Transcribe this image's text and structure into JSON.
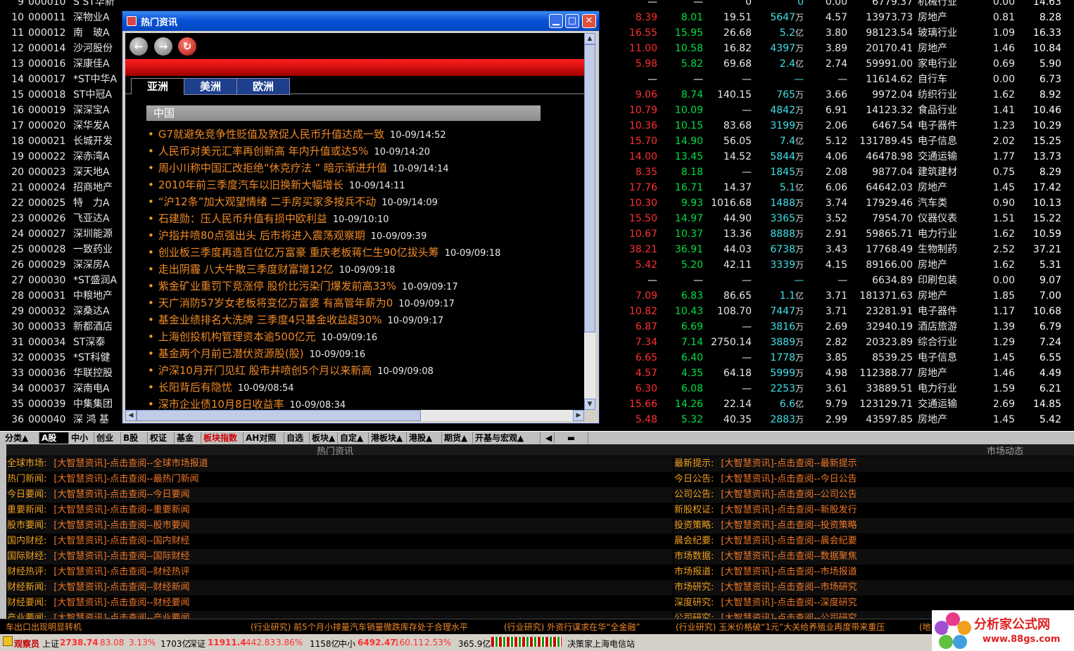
{
  "rows": [
    {
      "no": "9",
      "code": "000010",
      "name": "S ST华新",
      "a": "—",
      "b": "—",
      "c": "0",
      "d": "0",
      "e": "0.00",
      "f": "6779.37",
      "g": "机械行业",
      "h": "0.00",
      "i": "14.63"
    },
    {
      "no": "10",
      "code": "000011",
      "name": "深物业A",
      "a": "8.39",
      "b": "8.01",
      "c": "19.51",
      "d": "5647",
      "du": "万",
      "e": "4.57",
      "f": "13973.73",
      "g": "房地产",
      "h": "0.81",
      "i": "8.28"
    },
    {
      "no": "11",
      "code": "000012",
      "name": "南　玻A",
      "a": "16.55",
      "b": "15.95",
      "c": "26.68",
      "d": "5.2",
      "du": "亿",
      "e": "3.80",
      "f": "98123.54",
      "g": "玻璃行业",
      "h": "1.09",
      "i": "16.33"
    },
    {
      "no": "12",
      "code": "000014",
      "name": "沙河股份",
      "a": "11.00",
      "b": "10.58",
      "c": "16.82",
      "d": "4397",
      "du": "万",
      "e": "3.89",
      "f": "20170.41",
      "g": "房地产",
      "h": "1.46",
      "i": "10.84"
    },
    {
      "no": "13",
      "code": "000016",
      "name": "深康佳A",
      "a": "5.98",
      "b": "5.82",
      "c": "69.68",
      "d": "2.4",
      "du": "亿",
      "e": "2.74",
      "f": "59991.00",
      "g": "家电行业",
      "h": "0.69",
      "i": "5.90"
    },
    {
      "no": "14",
      "code": "000017",
      "name": "*ST中华A",
      "a": "—",
      "b": "—",
      "c": "—",
      "d": "—",
      "e": "—",
      "f": "11614.62",
      "g": "自行车",
      "h": "0.00",
      "i": "6.73"
    },
    {
      "no": "15",
      "code": "000018",
      "name": "ST中冠A",
      "a": "9.06",
      "b": "8.74",
      "c": "140.15",
      "d": "765",
      "du": "万",
      "e": "3.66",
      "f": "9972.04",
      "g": "纺织行业",
      "h": "1.62",
      "i": "8.92"
    },
    {
      "no": "16",
      "code": "000019",
      "name": "深深宝A",
      "a": "10.79",
      "b": "10.09",
      "c": "—",
      "d": "4842",
      "du": "万",
      "e": "6.91",
      "f": "14123.32",
      "g": "食品行业",
      "h": "1.41",
      "i": "10.46"
    },
    {
      "no": "17",
      "code": "000020",
      "name": "深华发A",
      "a": "10.36",
      "b": "10.15",
      "c": "83.68",
      "d": "3199",
      "du": "万",
      "e": "2.06",
      "f": "6467.54",
      "g": "电子器件",
      "h": "1.23",
      "i": "10.29"
    },
    {
      "no": "18",
      "code": "000021",
      "name": "长城开发",
      "a": "15.70",
      "b": "14.90",
      "c": "56.05",
      "d": "7.4",
      "du": "亿",
      "e": "5.12",
      "f": "131789.45",
      "g": "电子信息",
      "h": "2.02",
      "i": "15.25"
    },
    {
      "no": "19",
      "code": "000022",
      "name": "深赤湾A",
      "a": "14.00",
      "b": "13.45",
      "c": "14.52",
      "d": "5844",
      "du": "万",
      "e": "4.06",
      "f": "46478.98",
      "g": "交通运输",
      "h": "1.77",
      "i": "13.73"
    },
    {
      "no": "20",
      "code": "000023",
      "name": "深天地A",
      "a": "8.35",
      "b": "8.18",
      "c": "—",
      "d": "1845",
      "du": "万",
      "e": "2.08",
      "f": "9877.04",
      "g": "建筑建材",
      "h": "0.75",
      "i": "8.29"
    },
    {
      "no": "21",
      "code": "000024",
      "name": "招商地产",
      "a": "17.76",
      "b": "16.71",
      "c": "14.37",
      "d": "5.1",
      "du": "亿",
      "e": "6.06",
      "f": "64642.03",
      "g": "房地产",
      "h": "1.45",
      "i": "17.42"
    },
    {
      "no": "22",
      "code": "000025",
      "name": "特　力A",
      "a": "10.30",
      "b": "9.93",
      "c": "1016.68",
      "d": "1488",
      "du": "万",
      "e": "3.74",
      "f": "17929.46",
      "g": "汽车类",
      "h": "0.90",
      "i": "10.13"
    },
    {
      "no": "23",
      "code": "000026",
      "name": "飞亚达A",
      "a": "15.50",
      "b": "14.97",
      "c": "44.90",
      "d": "3365",
      "du": "万",
      "e": "3.52",
      "f": "7954.70",
      "g": "仪器仪表",
      "h": "1.51",
      "i": "15.22"
    },
    {
      "no": "24",
      "code": "000027",
      "name": "深圳能源",
      "a": "10.67",
      "b": "10.37",
      "c": "13.36",
      "d": "8888",
      "du": "万",
      "e": "2.91",
      "f": "59865.71",
      "g": "电力行业",
      "h": "1.62",
      "i": "10.59"
    },
    {
      "no": "25",
      "code": "000028",
      "name": "一致药业",
      "a": "38.21",
      "b": "36.91",
      "c": "44.03",
      "d": "6738",
      "du": "万",
      "e": "3.43",
      "f": "17768.49",
      "g": "生物制药",
      "h": "2.52",
      "i": "37.21"
    },
    {
      "no": "26",
      "code": "000029",
      "name": "深深房A",
      "a": "5.42",
      "b": "5.20",
      "c": "42.11",
      "d": "3339",
      "du": "万",
      "e": "4.15",
      "f": "89166.00",
      "g": "房地产",
      "h": "1.62",
      "i": "5.31"
    },
    {
      "no": "27",
      "code": "000030",
      "name": "*ST盛润A",
      "a": "—",
      "b": "—",
      "c": "—",
      "d": "—",
      "e": "—",
      "f": "6634.89",
      "g": "印刷包装",
      "h": "0.00",
      "i": "9.07"
    },
    {
      "no": "28",
      "code": "000031",
      "name": "中粮地产",
      "a": "7.09",
      "b": "6.83",
      "c": "86.65",
      "d": "1.1",
      "du": "亿",
      "e": "3.71",
      "f": "181371.63",
      "g": "房地产",
      "h": "1.85",
      "i": "7.00"
    },
    {
      "no": "29",
      "code": "000032",
      "name": "深桑达A",
      "a": "10.82",
      "b": "10.43",
      "c": "108.70",
      "d": "7447",
      "du": "万",
      "e": "3.71",
      "f": "23281.91",
      "g": "电子器件",
      "h": "1.17",
      "i": "10.68"
    },
    {
      "no": "30",
      "code": "000033",
      "name": "新都酒店",
      "a": "6.87",
      "b": "6.69",
      "c": "—",
      "d": "3816",
      "du": "万",
      "e": "2.69",
      "f": "32940.19",
      "g": "酒店旅游",
      "h": "1.39",
      "i": "6.79"
    },
    {
      "no": "31",
      "code": "000034",
      "name": "ST深泰",
      "a": "7.34",
      "b": "7.14",
      "c": "2750.14",
      "d": "3889",
      "du": "万",
      "e": "2.82",
      "f": "20323.89",
      "g": "综合行业",
      "h": "1.29",
      "i": "7.24"
    },
    {
      "no": "32",
      "code": "000035",
      "name": "*ST科健",
      "a": "6.65",
      "b": "6.40",
      "c": "—",
      "d": "1778",
      "du": "万",
      "e": "3.85",
      "f": "8539.25",
      "g": "电子信息",
      "h": "1.45",
      "i": "6.55"
    },
    {
      "no": "33",
      "code": "000036",
      "name": "华联控股",
      "a": "4.57",
      "b": "4.35",
      "c": "64.18",
      "d": "5999",
      "du": "万",
      "e": "4.98",
      "f": "112388.77",
      "g": "房地产",
      "h": "1.46",
      "i": "4.49"
    },
    {
      "no": "34",
      "code": "000037",
      "name": "深南电A",
      "a": "6.30",
      "b": "6.08",
      "c": "—",
      "d": "2253",
      "du": "万",
      "e": "3.61",
      "f": "33889.51",
      "g": "电力行业",
      "h": "1.59",
      "i": "6.21"
    },
    {
      "no": "35",
      "code": "000039",
      "name": "中集集团",
      "a": "15.66",
      "b": "14.26",
      "c": "22.14",
      "d": "6.6",
      "du": "亿",
      "e": "9.79",
      "f": "123129.71",
      "g": "交通运输",
      "h": "2.69",
      "i": "14.85"
    },
    {
      "no": "36",
      "code": "000040",
      "name": "深 鸿 基",
      "a": "5.48",
      "b": "5.32",
      "c": "40.35",
      "d": "2883",
      "du": "万",
      "e": "2.99",
      "f": "43597.85",
      "g": "房地产",
      "h": "1.45",
      "i": "5.42"
    }
  ],
  "window": {
    "title": "热门资讯",
    "tabs": [
      "亚洲",
      "美洲",
      "欧洲"
    ],
    "region": "中国",
    "news": [
      {
        "t": "G7就避免竞争性贬值及敦促人民币升值达成一致",
        "time": "10-09/14:52"
      },
      {
        "t": "人民币对美元汇率再创新高 年内升值或达5%",
        "time": "10-09/14:20"
      },
      {
        "t": "周小川称中国汇改拒绝“休克疗法 ” 暗示渐进升值",
        "time": "10-09/14:14"
      },
      {
        "t": "2010年前三季度汽车以旧换新大幅增长",
        "time": "10-09/14:11"
      },
      {
        "t": "“沪12条”加大观望情绪 二手房买家多按兵不动",
        "time": "10-09/14:09"
      },
      {
        "t": "石建勋：压人民币升值有损中欧利益",
        "time": "10-09/10:10"
      },
      {
        "t": "沪指井喷80点强出头 后市将进入震荡观察期",
        "time": "10-09/09:39"
      },
      {
        "t": "创业板三季度再造百位亿万富豪 重庆老板蒋仁生90亿拔头筹",
        "time": "10-09/09:18"
      },
      {
        "t": "走出阴霾 八大牛散三季度财富增12亿",
        "time": "10-09/09:18"
      },
      {
        "t": "紫金矿业重罚下竞涨停 股价比污染门爆发前高33%",
        "time": "10-09/09:17"
      },
      {
        "t": "天广消防57岁女老板将变亿万富婆 有高管年薪为0",
        "time": "10-09/09:17"
      },
      {
        "t": "基金业绩排名大洗牌 三季度4只基金收益超30%",
        "time": "10-09/09:17"
      },
      {
        "t": "上海创投机构管理资本逾500亿元",
        "time": "10-09/09:16"
      },
      {
        "t": "基金两个月前已潜伏资源股(股)",
        "time": "10-09/09:16"
      },
      {
        "t": "沪深10月开门见红 股市井喷创5个月以来新高",
        "time": "10-09/09:08"
      },
      {
        "t": "长阳背后有隐忧",
        "time": "10-09/08:54"
      },
      {
        "t": "深市企业债10月8日收益率",
        "time": "10-09/08:34"
      }
    ]
  },
  "strip": [
    "分类▲",
    "A股",
    "中小",
    "创业",
    "B股",
    "权证",
    "基金",
    "板块指数",
    "AH对照",
    "自选",
    "板块▲",
    "自定▲",
    "港板块▲",
    "港股▲",
    "期货▲",
    "开基与宏观▲"
  ],
  "info": {
    "left_title": "热门资讯",
    "right_title": "市场动态",
    "left": [
      {
        "l": "全球市场:",
        "v": "[大智慧资讯]-点击查阅--全球市场报道"
      },
      {
        "l": "热门新闻:",
        "v": "[大智慧资讯]-点击查阅--最热门新闻"
      },
      {
        "l": "今日要闻:",
        "v": "[大智慧资讯]-点击查阅--今日要闻"
      },
      {
        "l": "重要新闻:",
        "v": "[大智慧资讯]-点击查阅--重要新闻"
      },
      {
        "l": "股市要闻:",
        "v": "[大智慧资讯]-点击查阅--股市要闻"
      },
      {
        "l": "国内财经:",
        "v": "[大智慧资讯]-点击查阅--国内财经"
      },
      {
        "l": "国际财经:",
        "v": "[大智慧资讯]-点击查阅--国际财经"
      },
      {
        "l": "财经热评:",
        "v": "[大智慧资讯]-点击查阅--财经热评"
      },
      {
        "l": "财经新闻:",
        "v": "[大智慧资讯]-点击查阅--财经新闻"
      },
      {
        "l": "财经要闻:",
        "v": "[大智慧资讯]-点击查阅--财经要闻"
      },
      {
        "l": "产业要闻:",
        "v": "[大智慧资讯]-点击查阅--产业要闻"
      }
    ],
    "right": [
      {
        "l": "最新提示:",
        "v": "[大智慧资讯]-点击查阅--最新提示"
      },
      {
        "l": "今日公告:",
        "v": "[大智慧资讯]-点击查阅--今日公告"
      },
      {
        "l": "公司公告:",
        "v": "[大智慧资讯]-点击查阅--公司公告"
      },
      {
        "l": "新股权证:",
        "v": "[大智慧资讯]-点击查阅--新股发行"
      },
      {
        "l": "投资策略:",
        "v": "[大智慧资讯]-点击查阅--投资策略"
      },
      {
        "l": "晨会纪要:",
        "v": "[大智慧资讯]-点击查阅--晨会纪要"
      },
      {
        "l": "市场数据:",
        "v": "[大智慧资讯]-点击查阅--数据聚焦"
      },
      {
        "l": "市场报道:",
        "v": "[大智慧资讯]-点击查阅--市场报道"
      },
      {
        "l": "市场研究:",
        "v": "[大智慧资讯]-点击查阅--市场研究"
      },
      {
        "l": "深度研究:",
        "v": "[大智慧资讯]-点击查阅--深度研究"
      },
      {
        "l": "公司研究:",
        "v": "[大智慧资讯]-点击查阅--公司研究"
      }
    ]
  },
  "ticker": [
    "车出口出现明显转机",
    "(行业研究) 前5个月小排量汽车销量微跌库存处于合理水平",
    "(行业研究) 外资行谋求在华“全金融”",
    "(行业研究) 玉米价格破“1元”大关给养殖业再度带来重压",
    "(地"
  ],
  "status": {
    "app": "观察员",
    "sh_label": "上证",
    "sh_val": "2738.74",
    "sh_chg": "83.08",
    "sh_pct": "3.13%",
    "sh_amt": "1703亿",
    "sz_label": "深证",
    "sz_val": "11911.4",
    "sz_chg": "442.83",
    "sz_pct": "3.86%",
    "sz_amt": "1158亿",
    "zx_label": "中小",
    "zx_val": "6492.47",
    "zx_chg": "160.11",
    "zx_pct": "2.53%",
    "zx_amt": "365.9亿",
    "site": "决策家上海电信站"
  },
  "logo": {
    "name": "分析家公式网",
    "url": "www.88gs.com"
  }
}
